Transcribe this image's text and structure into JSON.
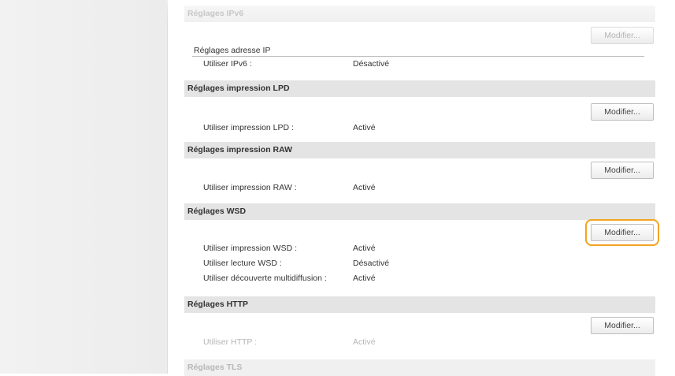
{
  "sections": {
    "ipv6": {
      "title": "Réglages IPv6",
      "button": "Modifier...",
      "subheader": "Réglages adresse IP",
      "rows": [
        {
          "label": "Utiliser IPv6 :",
          "value": "Désactivé"
        }
      ]
    },
    "lpd": {
      "title": "Réglages impression LPD",
      "button": "Modifier...",
      "rows": [
        {
          "label": "Utiliser impression LPD :",
          "value": "Activé"
        }
      ]
    },
    "raw": {
      "title": "Réglages impression RAW",
      "button": "Modifier...",
      "rows": [
        {
          "label": "Utiliser impression RAW :",
          "value": "Activé"
        }
      ]
    },
    "wsd": {
      "title": "Réglages WSD",
      "button": "Modifier...",
      "rows": [
        {
          "label": "Utiliser impression WSD :",
          "value": "Activé"
        },
        {
          "label": "Utiliser lecture WSD :",
          "value": "Désactivé"
        },
        {
          "label": "Utiliser découverte multidiffusion :",
          "value": "Activé"
        }
      ]
    },
    "http": {
      "title": "Réglages HTTP",
      "button": "Modifier...",
      "rows": [
        {
          "label": "Utiliser HTTP :",
          "value": "Activé"
        }
      ]
    },
    "tls": {
      "title": "Réglages TLS"
    }
  },
  "colors": {
    "highlight": "#f2a41e",
    "header_bg": "#e4e4e4"
  }
}
